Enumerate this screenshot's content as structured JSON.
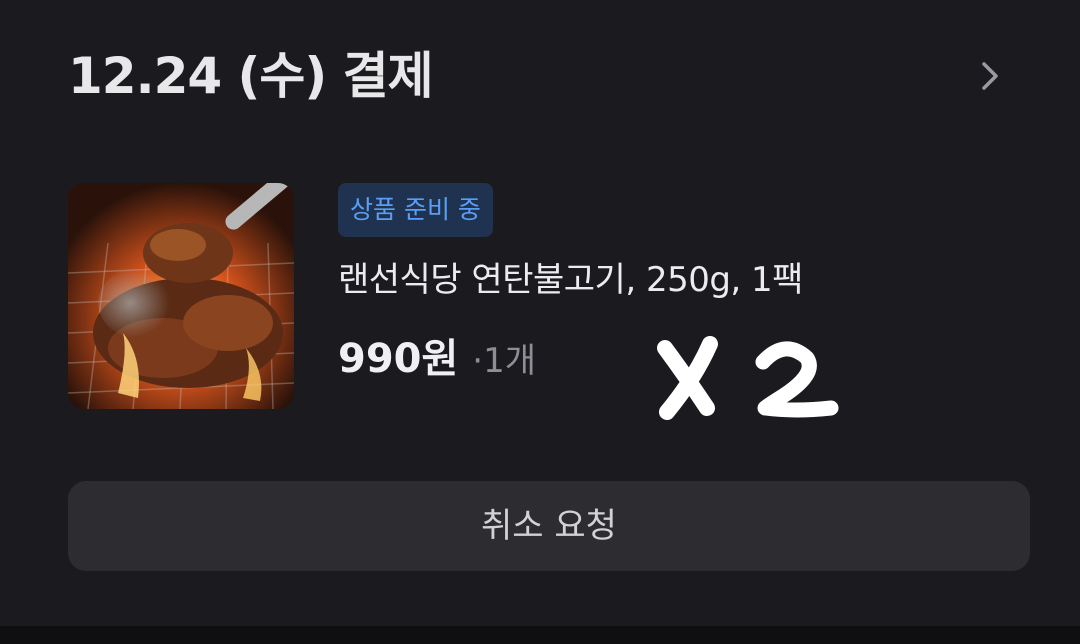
{
  "order": {
    "header_title": "12.24 (수) 결제",
    "status_badge": "상품 준비 중",
    "product_name": "랜선식당 연탄불고기, 250g, 1팩",
    "price": "990원",
    "quantity": "·1개",
    "handwritten_note": "x 2",
    "cancel_label": "취소 요청",
    "icons": {
      "chevron": "chevron-right-icon",
      "thumbnail": "product-thumbnail"
    },
    "colors": {
      "card_bg": "#1b1b1f",
      "badge_bg": "#1f3350",
      "badge_text": "#5a9ef5",
      "button_bg": "#2c2c31"
    }
  }
}
